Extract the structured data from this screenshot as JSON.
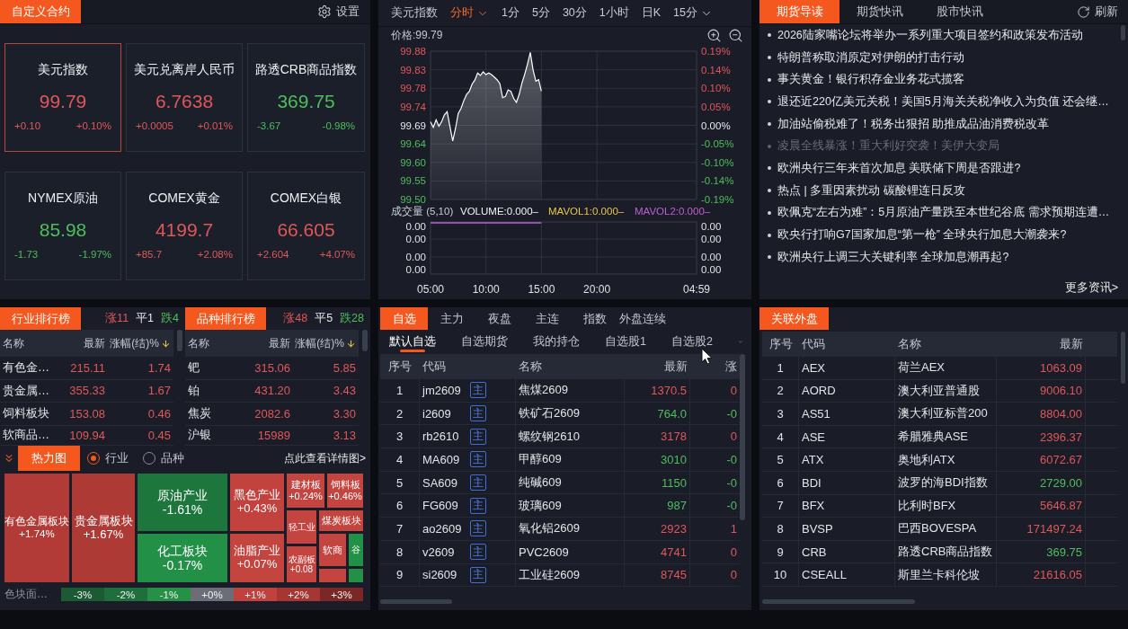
{
  "custom_contracts": {
    "title": "自定义合约",
    "settings": "设置",
    "cards": [
      {
        "name": "美元指数",
        "value": "99.79",
        "change": "+0.10",
        "percent": "+0.10%",
        "up": true,
        "selected": true
      },
      {
        "name": "美元兑离岸人民币",
        "value": "6.7638",
        "change": "+0.0005",
        "percent": "+0.01%",
        "up": true,
        "selected": false
      },
      {
        "name": "路透CRB商品指数",
        "value": "369.75",
        "change": "-3.67",
        "percent": "-0.98%",
        "up": false,
        "selected": false
      },
      {
        "name": "NYMEX原油",
        "value": "85.98",
        "change": "-1.73",
        "percent": "-1.97%",
        "up": false,
        "selected": false
      },
      {
        "name": "COMEX黄金",
        "value": "4199.7",
        "change": "+85.7",
        "percent": "+2.08%",
        "up": true,
        "selected": false
      },
      {
        "name": "COMEX白银",
        "value": "66.605",
        "change": "+2.604",
        "percent": "+4.07%",
        "up": true,
        "selected": false
      }
    ]
  },
  "intraday_chart": {
    "symbol": "美元指数",
    "periods": [
      {
        "label": "分时",
        "selected": true,
        "dropdown": true
      },
      {
        "label": "1分",
        "selected": false,
        "dropdown": false
      },
      {
        "label": "5分",
        "selected": false,
        "dropdown": false
      },
      {
        "label": "30分",
        "selected": false,
        "dropdown": false
      },
      {
        "label": "1小时",
        "selected": false,
        "dropdown": false
      },
      {
        "label": "日K",
        "selected": false,
        "dropdown": false
      },
      {
        "label": "15分",
        "selected": false,
        "dropdown": true
      }
    ],
    "price_label": "价格:99.79",
    "chart_data": {
      "type": "area",
      "grid": true,
      "categories": [
        null,
        null,
        null,
        null,
        null,
        null,
        null,
        null,
        null,
        null,
        null,
        null,
        null,
        null,
        null,
        null,
        null,
        null,
        null,
        null,
        null,
        null,
        null,
        null,
        null,
        null,
        null,
        null,
        null,
        null,
        null,
        null,
        null,
        null,
        null,
        null,
        null,
        null,
        null,
        null,
        null,
        null,
        null,
        null,
        null,
        null,
        null,
        null,
        null,
        null,
        null,
        null,
        null,
        null,
        null,
        null,
        null,
        null,
        null,
        null,
        null,
        null,
        null,
        null,
        null,
        null,
        null,
        null,
        null,
        null,
        null,
        null,
        null,
        null,
        null,
        null,
        null,
        null,
        null,
        null,
        null,
        null,
        null,
        null,
        null,
        null,
        null,
        null,
        null,
        null,
        null,
        null,
        null,
        null,
        null,
        null,
        null
      ],
      "series": [
        {
          "color": "#ffffff",
          "values": [
            99.699,
            99.685,
            99.704,
            99.688,
            99.699,
            99.717,
            99.725,
            99.687,
            99.65,
            99.682,
            99.72,
            99.733,
            99.753,
            99.769,
            99.777,
            99.796,
            99.806,
            99.824,
            99.818,
            99.827,
            99.82,
            99.824,
            99.82,
            99.814,
            99.807,
            99.797,
            99.761,
            99.764,
            99.781,
            99.777,
            99.759,
            99.749,
            99.77,
            99.799,
            99.821,
            99.847,
            99.877,
            99.832,
            99.803,
            99.807,
            99.778,
            null,
            null,
            null,
            null,
            null,
            null,
            null,
            null,
            null,
            null,
            null,
            null,
            null,
            null,
            null,
            null,
            null,
            null,
            null,
            null,
            null,
            null,
            null,
            null,
            null,
            null,
            null,
            null,
            null,
            null,
            null,
            null,
            null,
            null,
            null,
            null,
            null,
            null,
            null,
            null,
            null,
            null,
            null,
            null,
            null,
            null,
            null,
            null,
            null,
            null,
            null,
            null,
            null,
            null,
            null,
            null
          ]
        }
      ],
      "ylim": [
        99.5,
        99.88
      ],
      "yticks": [
        {
          "value": 99.88,
          "label": "99.88"
        },
        {
          "value": 99.8325,
          "label": "99.83"
        },
        {
          "value": 99.785,
          "label": "99.78"
        },
        {
          "value": 99.7375,
          "label": "99.74"
        },
        {
          "value": 99.69,
          "label": "99.69"
        },
        {
          "value": 99.6425,
          "label": "99.64"
        },
        {
          "value": 99.595,
          "label": "99.60"
        },
        {
          "value": 99.5475,
          "label": "99.55"
        },
        {
          "value": 99.5,
          "label": "99.50"
        }
      ]
    },
    "percent_ticks": [
      "0.19%",
      "0.14%",
      "0.10%",
      "0.05%",
      "0.00%",
      "-0.05%",
      "-0.10%",
      "-0.14%",
      "-0.19%"
    ],
    "volume": {
      "legend": [
        {
          "label": "成交量 (5,10)",
          "color": "#c8ccd4"
        },
        {
          "label": "VOLUME:0.000–",
          "color": "#f2f3f5"
        },
        {
          "label": "MAVOL1:0.000–",
          "color": "#e8c547"
        },
        {
          "label": "MAVOL2:0.000–",
          "color": "#c15ed6"
        }
      ],
      "left_ticks": [
        "0.00",
        "0.00",
        "0.00",
        "0.00"
      ],
      "right_ticks": [
        "0.00",
        "0.00",
        "0.00",
        "0.00"
      ]
    },
    "time_axis": [
      "05:00",
      "10:00",
      "15:00",
      "20:00",
      "04:59"
    ]
  },
  "news": {
    "tabs": [
      {
        "label": "期货导读",
        "selected": true
      },
      {
        "label": "期货快讯",
        "selected": false
      },
      {
        "label": "股市快讯",
        "selected": false
      }
    ],
    "refresh": "刷新",
    "items": [
      {
        "title": "2026陆家嘴论坛将举办一系列重大项目签约和政策发布活动",
        "read": false
      },
      {
        "title": "特朗普称取消原定对伊朗的打击行动",
        "read": false
      },
      {
        "title": "事关黄金！银行积存金业务花式揽客",
        "read": false
      },
      {
        "title": "退还近220亿美元关税！美国5月海关关税净收入为负值 还会继…",
        "read": false
      },
      {
        "title": "加油站偷税难了！税务出狠招 助推成品油消费税改革",
        "read": false
      },
      {
        "title": "凌晨全线暴涨！重大利好突袭！美伊大变局",
        "read": true
      },
      {
        "title": "欧洲央行三年来首次加息 美联储下周是否跟进?",
        "read": false
      },
      {
        "title": "热点 | 多重因素扰动 碳酸锂连日反攻",
        "read": false
      },
      {
        "title": "欧佩克“左右为难”：5月原油产量跌至本世纪谷底 需求预期连遭…",
        "read": false
      },
      {
        "title": "欧央行打响G7国家加息“第一枪” 全球央行加息大潮袭来?",
        "read": false
      },
      {
        "title": "欧洲央行上调三大关键利率 全球加息潮再起?",
        "read": false
      }
    ],
    "more": "更多资讯>"
  },
  "rankings": [
    {
      "title": "行业排行榜",
      "counts": [
        {
          "label": "涨11",
          "color": "#e0575a"
        },
        {
          "label": "平1",
          "color": "#e6e8ec"
        },
        {
          "label": "跌4",
          "color": "#4fbd5d"
        }
      ],
      "columns": [
        {
          "label": "名称",
          "sorted": false
        },
        {
          "label": "最新",
          "sorted": false
        },
        {
          "label": "涨幅(结)%",
          "sorted": true
        }
      ],
      "rows": [
        {
          "name": "有色金…",
          "latest": "215.11",
          "percent": "1.74",
          "up": true
        },
        {
          "name": "贵金属…",
          "latest": "355.33",
          "percent": "1.67",
          "up": true
        },
        {
          "name": "饲料板块",
          "latest": "153.08",
          "percent": "0.46",
          "up": true
        },
        {
          "name": "软商品…",
          "latest": "109.94",
          "percent": "0.45",
          "up": true
        }
      ]
    },
    {
      "title": "品种排行榜",
      "counts": [
        {
          "label": "涨48",
          "color": "#e0575a"
        },
        {
          "label": "平5",
          "color": "#e6e8ec"
        },
        {
          "label": "跌28",
          "color": "#4fbd5d"
        }
      ],
      "columns": [
        {
          "label": "名称",
          "sorted": false
        },
        {
          "label": "最新",
          "sorted": false
        },
        {
          "label": "涨幅(结)%",
          "sorted": true
        }
      ],
      "rows": [
        {
          "name": "钯",
          "latest": "315.06",
          "percent": "5.85",
          "up": true
        },
        {
          "name": "铂",
          "latest": "431.20",
          "percent": "3.43",
          "up": true
        },
        {
          "name": "焦炭",
          "latest": "2082.6",
          "percent": "3.30",
          "up": true
        },
        {
          "name": "沪银",
          "latest": "15989",
          "percent": "3.13",
          "up": true
        }
      ]
    }
  ],
  "heatmap": {
    "title": "热力图",
    "modes": [
      {
        "label": "行业",
        "selected": true
      },
      {
        "label": "品种",
        "selected": false
      }
    ],
    "detail_link": "点此查看详情图>",
    "cells": [
      {
        "name": "有色金属板块",
        "percent": "+1.74%",
        "color": "#b23b38"
      },
      {
        "name": "贵金属板块",
        "percent": "+1.67%",
        "color": "#ae3a36"
      },
      {
        "name": "原油产业",
        "percent": "-1.61%",
        "color": "#1d773d"
      },
      {
        "name": "化工板块",
        "percent": "-0.17%",
        "color": "#229047"
      },
      {
        "name": "黑色产业",
        "percent": "+0.43%",
        "color": "#c2423d"
      },
      {
        "name": "油脂产业",
        "percent": "+0.07%",
        "color": "#c4443f"
      },
      {
        "name": "建材板",
        "percent": "+0.24%",
        "color": "#c4443f"
      },
      {
        "name": "饲料板",
        "percent": "+0.46%",
        "color": "#c4443f"
      },
      {
        "name": "轻工业",
        "color": "#c4443f"
      },
      {
        "name": "煤炭板块",
        "color": "#c4443f"
      },
      {
        "name": "农副板",
        "percent": "+0.08",
        "color": "#c4443f"
      },
      {
        "name": "软商",
        "color": "#c4443f"
      },
      {
        "name": "谷",
        "color": "#229047"
      },
      {
        "color": "#c4443f"
      },
      {
        "color": "#229047"
      }
    ],
    "legend_label": "色块面…",
    "scale": [
      {
        "label": "-3%",
        "color": "#1b5a33"
      },
      {
        "label": "-2%",
        "color": "#1f6f3d"
      },
      {
        "label": "-1%",
        "color": "#259046"
      },
      {
        "label": "+0%",
        "color": "#6b6e77"
      },
      {
        "label": "+1%",
        "color": "#c0413d"
      },
      {
        "label": "+2%",
        "color": "#a53632"
      },
      {
        "label": "+3%",
        "color": "#7b2725"
      }
    ]
  },
  "watchlist": {
    "tabs": [
      {
        "label": "自选",
        "selected": true
      },
      {
        "label": "主力",
        "selected": false
      },
      {
        "label": "夜盘",
        "selected": false
      },
      {
        "label": "主连",
        "selected": false
      },
      {
        "label": "指数",
        "selected": false
      },
      {
        "label": "外盘连续",
        "selected": false
      }
    ],
    "subtabs": [
      {
        "label": "默认自选",
        "selected": true
      },
      {
        "label": "自选期货",
        "selected": false
      },
      {
        "label": "我的持仓",
        "selected": false
      },
      {
        "label": "自选股1",
        "selected": false
      },
      {
        "label": "自选股2",
        "selected": false
      }
    ],
    "columns": [
      "序号",
      "代码",
      "名称",
      "最新",
      "涨"
    ],
    "rows": [
      {
        "index": "1",
        "code": "jm2609",
        "tag": "主",
        "name": "焦煤2609",
        "latest": "1370.5",
        "change": "0",
        "up": true
      },
      {
        "index": "2",
        "code": "i2609",
        "tag": "主",
        "name": "铁矿石2609",
        "latest": "764.0",
        "change": "-0",
        "up": false
      },
      {
        "index": "3",
        "code": "rb2610",
        "tag": "主",
        "name": "螺纹钢2610",
        "latest": "3178",
        "change": "0",
        "up": true
      },
      {
        "index": "4",
        "code": "MA609",
        "tag": "主",
        "name": "甲醇609",
        "latest": "3010",
        "change": "-0",
        "up": false
      },
      {
        "index": "5",
        "code": "SA609",
        "tag": "主",
        "name": "纯碱609",
        "latest": "1150",
        "change": "-0",
        "up": false
      },
      {
        "index": "6",
        "code": "FG609",
        "tag": "主",
        "name": "玻璃609",
        "latest": "987",
        "change": "-0",
        "up": false
      },
      {
        "index": "7",
        "code": "ao2609",
        "tag": "主",
        "name": "氧化铝2609",
        "latest": "2923",
        "change": "1",
        "up": true
      },
      {
        "index": "8",
        "code": "v2609",
        "tag": "主",
        "name": "PVC2609",
        "latest": "4741",
        "change": "0",
        "up": true
      },
      {
        "index": "9",
        "code": "si2609",
        "tag": "主",
        "name": "工业硅2609",
        "latest": "8745",
        "change": "0",
        "up": true
      }
    ]
  },
  "foreign_markets": {
    "title": "关联外盘",
    "columns": [
      "序号",
      "代码",
      "名称",
      "最新"
    ],
    "rows": [
      {
        "index": "1",
        "code": "AEX",
        "name": "荷兰AEX",
        "latest": "1063.09",
        "up": true
      },
      {
        "index": "2",
        "code": "AORD",
        "name": "澳大利亚普通股",
        "latest": "9006.10",
        "up": true
      },
      {
        "index": "3",
        "code": "AS51",
        "name": "澳大利亚标普200",
        "latest": "8804.00",
        "up": true
      },
      {
        "index": "4",
        "code": "ASE",
        "name": "希腊雅典ASE",
        "latest": "2396.37",
        "up": true
      },
      {
        "index": "5",
        "code": "ATX",
        "name": "奥地利ATX",
        "latest": "6072.67",
        "up": true
      },
      {
        "index": "6",
        "code": "BDI",
        "name": "波罗的海BDI指数",
        "latest": "2729.00",
        "up": false
      },
      {
        "index": "7",
        "code": "BFX",
        "name": "比利时BFX",
        "latest": "5646.87",
        "up": true
      },
      {
        "index": "8",
        "code": "BVSP",
        "name": "巴西BOVESPA",
        "latest": "171497.24",
        "up": true
      },
      {
        "index": "9",
        "code": "CRB",
        "name": "路透CRB商品指数",
        "latest": "369.75",
        "up": false
      },
      {
        "index": "10",
        "code": "CSEALL",
        "name": "斯里兰卡科伦坡",
        "latest": "21616.05",
        "up": true
      }
    ]
  }
}
